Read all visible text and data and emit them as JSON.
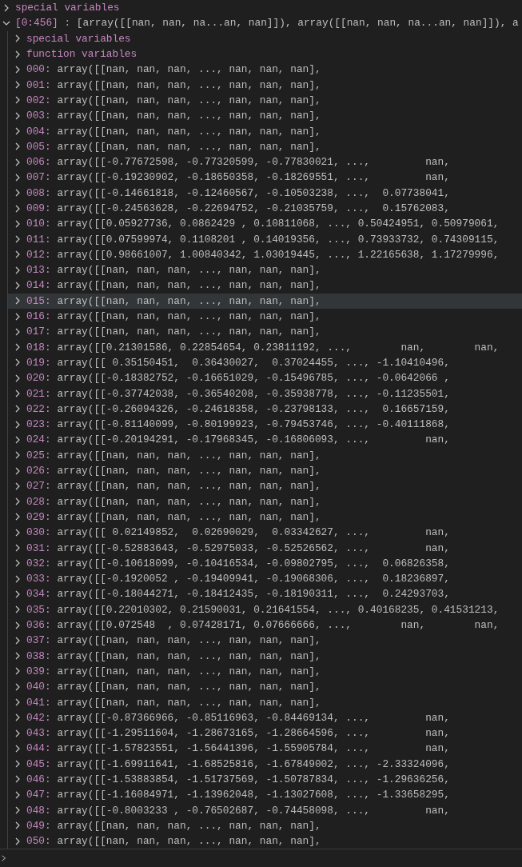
{
  "variables": [
    {
      "name": "special variables",
      "expanded": false,
      "selected": false
    },
    {
      "name": "[0:456] :",
      "value": "[array([[nan, nan, na...an, nan]]), array([[nan, nan, na...an, nan]]), a",
      "expanded": true,
      "selected": false,
      "children": [
        {
          "name": "special variables",
          "expanded": false,
          "selected": false
        },
        {
          "name": "function variables",
          "expanded": false,
          "selected": false
        },
        {
          "name": "000:",
          "value": "array([[nan, nan, nan, ..., nan, nan, nan],",
          "expanded": false,
          "selected": false
        },
        {
          "name": "001:",
          "value": "array([[nan, nan, nan, ..., nan, nan, nan],",
          "expanded": false,
          "selected": false
        },
        {
          "name": "002:",
          "value": "array([[nan, nan, nan, ..., nan, nan, nan],",
          "expanded": false,
          "selected": false
        },
        {
          "name": "003:",
          "value": "array([[nan, nan, nan, ..., nan, nan, nan],",
          "expanded": false,
          "selected": false
        },
        {
          "name": "004:",
          "value": "array([[nan, nan, nan, ..., nan, nan, nan],",
          "expanded": false,
          "selected": false
        },
        {
          "name": "005:",
          "value": "array([[nan, nan, nan, ..., nan, nan, nan],",
          "expanded": false,
          "selected": false
        },
        {
          "name": "006:",
          "value": "array([[-0.77672598, -0.77320599, -0.77830021, ...,         nan,",
          "expanded": false,
          "selected": false
        },
        {
          "name": "007:",
          "value": "array([[-0.19230902, -0.18650358, -0.18269551, ...,         nan,",
          "expanded": false,
          "selected": false
        },
        {
          "name": "008:",
          "value": "array([[-0.14661818, -0.12460567, -0.10503238, ...,  0.07738041,",
          "expanded": false,
          "selected": false
        },
        {
          "name": "009:",
          "value": "array([[-0.24563628, -0.22694752, -0.21035759, ...,  0.15762083,",
          "expanded": false,
          "selected": false
        },
        {
          "name": "010:",
          "value": "array([[0.05927736, 0.0862429 , 0.10811068, ..., 0.50424951, 0.50979061,",
          "expanded": false,
          "selected": false
        },
        {
          "name": "011:",
          "value": "array([[0.07599974, 0.1108201 , 0.14019356, ..., 0.73933732, 0.74309115,",
          "expanded": false,
          "selected": false
        },
        {
          "name": "012:",
          "value": "array([[0.98661007, 1.00840342, 1.03019445, ..., 1.22165638, 1.17279996,",
          "expanded": false,
          "selected": false
        },
        {
          "name": "013:",
          "value": "array([[nan, nan, nan, ..., nan, nan, nan],",
          "expanded": false,
          "selected": false
        },
        {
          "name": "014:",
          "value": "array([[nan, nan, nan, ..., nan, nan, nan],",
          "expanded": false,
          "selected": false
        },
        {
          "name": "015:",
          "value": "array([[nan, nan, nan, ..., nan, nan, nan],",
          "expanded": false,
          "selected": true
        },
        {
          "name": "016:",
          "value": "array([[nan, nan, nan, ..., nan, nan, nan],",
          "expanded": false,
          "selected": false
        },
        {
          "name": "017:",
          "value": "array([[nan, nan, nan, ..., nan, nan, nan],",
          "expanded": false,
          "selected": false
        },
        {
          "name": "018:",
          "value": "array([[0.21301586, 0.22854654, 0.23811192, ...,        nan,        nan,",
          "expanded": false,
          "selected": false
        },
        {
          "name": "019:",
          "value": "array([[ 0.35150451,  0.36430027,  0.37024455, ..., -1.10410496,",
          "expanded": false,
          "selected": false
        },
        {
          "name": "020:",
          "value": "array([[-0.18382752, -0.16651029, -0.15496785, ..., -0.0642066 ,",
          "expanded": false,
          "selected": false
        },
        {
          "name": "021:",
          "value": "array([[-0.37742038, -0.36540208, -0.35938778, ..., -0.11235501,",
          "expanded": false,
          "selected": false
        },
        {
          "name": "022:",
          "value": "array([[-0.26094326, -0.24618358, -0.23798133, ...,  0.16657159,",
          "expanded": false,
          "selected": false
        },
        {
          "name": "023:",
          "value": "array([[-0.81140099, -0.80199923, -0.79453746, ..., -0.40111868,",
          "expanded": false,
          "selected": false
        },
        {
          "name": "024:",
          "value": "array([[-0.20194291, -0.17968345, -0.16806093, ...,         nan,",
          "expanded": false,
          "selected": false
        },
        {
          "name": "025:",
          "value": "array([[nan, nan, nan, ..., nan, nan, nan],",
          "expanded": false,
          "selected": false
        },
        {
          "name": "026:",
          "value": "array([[nan, nan, nan, ..., nan, nan, nan],",
          "expanded": false,
          "selected": false
        },
        {
          "name": "027:",
          "value": "array([[nan, nan, nan, ..., nan, nan, nan],",
          "expanded": false,
          "selected": false
        },
        {
          "name": "028:",
          "value": "array([[nan, nan, nan, ..., nan, nan, nan],",
          "expanded": false,
          "selected": false
        },
        {
          "name": "029:",
          "value": "array([[nan, nan, nan, ..., nan, nan, nan],",
          "expanded": false,
          "selected": false
        },
        {
          "name": "030:",
          "value": "array([[ 0.02149852,  0.02690029,  0.03342627, ...,         nan,",
          "expanded": false,
          "selected": false
        },
        {
          "name": "031:",
          "value": "array([[-0.52883643, -0.52975033, -0.52526562, ...,         nan,",
          "expanded": false,
          "selected": false
        },
        {
          "name": "032:",
          "value": "array([[-0.10618099, -0.10416534, -0.09802795, ...,  0.06826358,",
          "expanded": false,
          "selected": false
        },
        {
          "name": "033:",
          "value": "array([[-0.1920052 , -0.19409941, -0.19068306, ...,  0.18236897,",
          "expanded": false,
          "selected": false
        },
        {
          "name": "034:",
          "value": "array([[-0.18044271, -0.18412435, -0.18190311, ...,  0.24293703,",
          "expanded": false,
          "selected": false
        },
        {
          "name": "035:",
          "value": "array([[0.22010302, 0.21590031, 0.21641554, ..., 0.40168235, 0.41531213,",
          "expanded": false,
          "selected": false
        },
        {
          "name": "036:",
          "value": "array([[0.072548  , 0.07428171, 0.07666666, ...,        nan,        nan,",
          "expanded": false,
          "selected": false
        },
        {
          "name": "037:",
          "value": "array([[nan, nan, nan, ..., nan, nan, nan],",
          "expanded": false,
          "selected": false
        },
        {
          "name": "038:",
          "value": "array([[nan, nan, nan, ..., nan, nan, nan],",
          "expanded": false,
          "selected": false
        },
        {
          "name": "039:",
          "value": "array([[nan, nan, nan, ..., nan, nan, nan],",
          "expanded": false,
          "selected": false
        },
        {
          "name": "040:",
          "value": "array([[nan, nan, nan, ..., nan, nan, nan],",
          "expanded": false,
          "selected": false
        },
        {
          "name": "041:",
          "value": "array([[nan, nan, nan, ..., nan, nan, nan],",
          "expanded": false,
          "selected": false
        },
        {
          "name": "042:",
          "value": "array([[-0.87366966, -0.85116963, -0.84469134, ...,         nan,",
          "expanded": false,
          "selected": false
        },
        {
          "name": "043:",
          "value": "array([[-1.29511604, -1.28673165, -1.28664596, ...,         nan,",
          "expanded": false,
          "selected": false
        },
        {
          "name": "044:",
          "value": "array([[-1.57823551, -1.56441396, -1.55905784, ...,         nan,",
          "expanded": false,
          "selected": false
        },
        {
          "name": "045:",
          "value": "array([[-1.69911641, -1.68525816, -1.67849002, ..., -2.33324096,",
          "expanded": false,
          "selected": false
        },
        {
          "name": "046:",
          "value": "array([[-1.53883854, -1.51737569, -1.50787834, ..., -1.29636256,",
          "expanded": false,
          "selected": false
        },
        {
          "name": "047:",
          "value": "array([[-1.16084971, -1.13962048, -1.13027608, ..., -1.33658295,",
          "expanded": false,
          "selected": false
        },
        {
          "name": "048:",
          "value": "array([[-0.8003233 , -0.76502687, -0.74458098, ...,         nan,",
          "expanded": false,
          "selected": false
        },
        {
          "name": "049:",
          "value": "array([[nan, nan, nan, ..., nan, nan, nan],",
          "expanded": false,
          "selected": false
        },
        {
          "name": "050:",
          "value": "array([[nan, nan, nan, ..., nan, nan, nan],",
          "expanded": false,
          "selected": false
        }
      ]
    }
  ]
}
